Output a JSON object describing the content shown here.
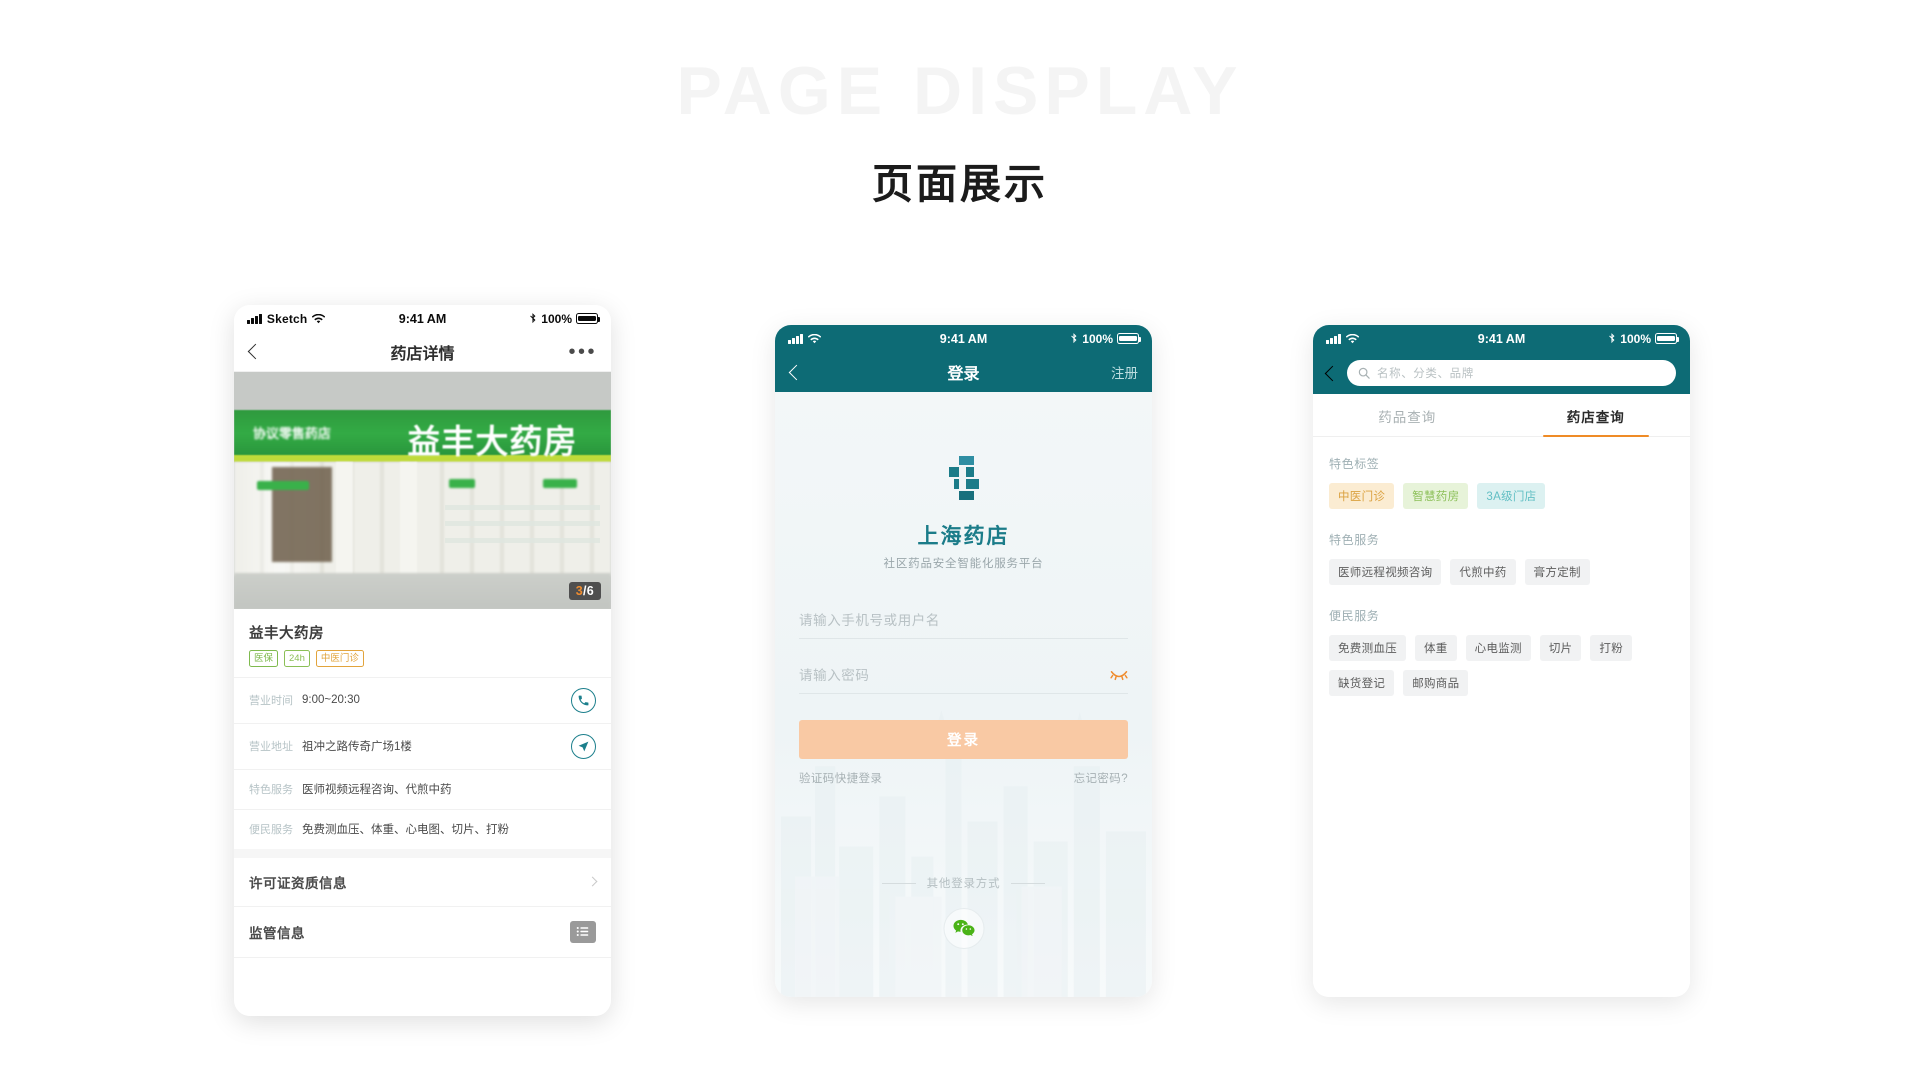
{
  "header": {
    "ghost_title": "PAGE DISPLAY",
    "cn_title": "页面展示"
  },
  "phone1": {
    "status": {
      "carrier": "Sketch",
      "time": "9:41 AM",
      "battery": "100%"
    },
    "nav": {
      "title": "药店详情",
      "back_icon": "back-chevron-icon",
      "more_icon": "more-dots-icon"
    },
    "photo": {
      "sign_text": "益丰大药房",
      "sign_text_small": "协议零售药店",
      "counter_current": "3",
      "counter_total": "/6"
    },
    "shop": {
      "name": "益丰大药房",
      "tags": [
        {
          "label": "医保",
          "style": "green"
        },
        {
          "label": "24h",
          "style": "green2"
        },
        {
          "label": "中医门诊",
          "style": "amber"
        }
      ]
    },
    "info_rows": [
      {
        "label": "营业时间",
        "value": "9:00~20:30",
        "action_icon": "phone-icon"
      },
      {
        "label": "营业地址",
        "value": "祖冲之路传奇广场1楼",
        "action_icon": "navigate-icon"
      },
      {
        "label": "特色服务",
        "value": "医师视频远程咨询、代煎中药",
        "action_icon": ""
      },
      {
        "label": "便民服务",
        "value": "免费测血压、体重、心电图、切片、打粉",
        "action_icon": ""
      }
    ],
    "link_rows": [
      {
        "label": "许可证资质信息",
        "action_icon": "chevron-right-icon"
      },
      {
        "label": "监管信息",
        "action_icon": "list-icon"
      }
    ]
  },
  "phone2": {
    "status": {
      "carrier": "",
      "time": "9:41 AM",
      "battery": "100%"
    },
    "nav": {
      "title": "登录",
      "right_label": "注册",
      "back_icon": "back-chevron-icon"
    },
    "brand": {
      "logo_icon": "pharmacy-cross-logo",
      "name": "上海药店",
      "subtitle": "社区药品安全智能化服务平台"
    },
    "form": {
      "account_placeholder": "请输入手机号或用户名",
      "account_value": "",
      "password_placeholder": "请输入密码",
      "password_value": "",
      "password_toggle_icon": "eye-off-icon",
      "submit_label": "登录"
    },
    "sub_links": {
      "left": "验证码快捷登录",
      "right": "忘记密码?"
    },
    "other_login": {
      "divider_label": "其他登录方式",
      "wechat_icon": "wechat-icon"
    },
    "colors": {
      "header": "#0d6b75",
      "brand": "#1b7c89",
      "button": "#f9c9a4"
    }
  },
  "phone3": {
    "status": {
      "carrier": "",
      "time": "9:41 AM",
      "battery": "100%"
    },
    "search": {
      "placeholder": "名称、分类、品牌",
      "value": "",
      "icon": "search-icon",
      "back_icon": "back-chevron-icon"
    },
    "tabs": [
      {
        "label": "药品查询",
        "active": false
      },
      {
        "label": "药店查询",
        "active": true
      }
    ],
    "sections": [
      {
        "title": "特色标签",
        "chips": [
          {
            "label": "中医门诊",
            "style": "amber"
          },
          {
            "label": "智慧药房",
            "style": "green"
          },
          {
            "label": "3A级门店",
            "style": "teal"
          }
        ]
      },
      {
        "title": "特色服务",
        "chips": [
          {
            "label": "医师远程视频咨询",
            "style": "gray"
          },
          {
            "label": "代煎中药",
            "style": "gray"
          },
          {
            "label": "膏方定制",
            "style": "gray"
          }
        ]
      },
      {
        "title": "便民服务",
        "chips": [
          {
            "label": "免费测血压",
            "style": "gray"
          },
          {
            "label": "体重",
            "style": "gray"
          },
          {
            "label": "心电监测",
            "style": "gray"
          },
          {
            "label": "切片",
            "style": "gray"
          },
          {
            "label": "打粉",
            "style": "gray"
          },
          {
            "label": "缺货登记",
            "style": "gray"
          },
          {
            "label": "邮购商品",
            "style": "gray"
          }
        ]
      }
    ],
    "accent": "#ef8b26"
  }
}
